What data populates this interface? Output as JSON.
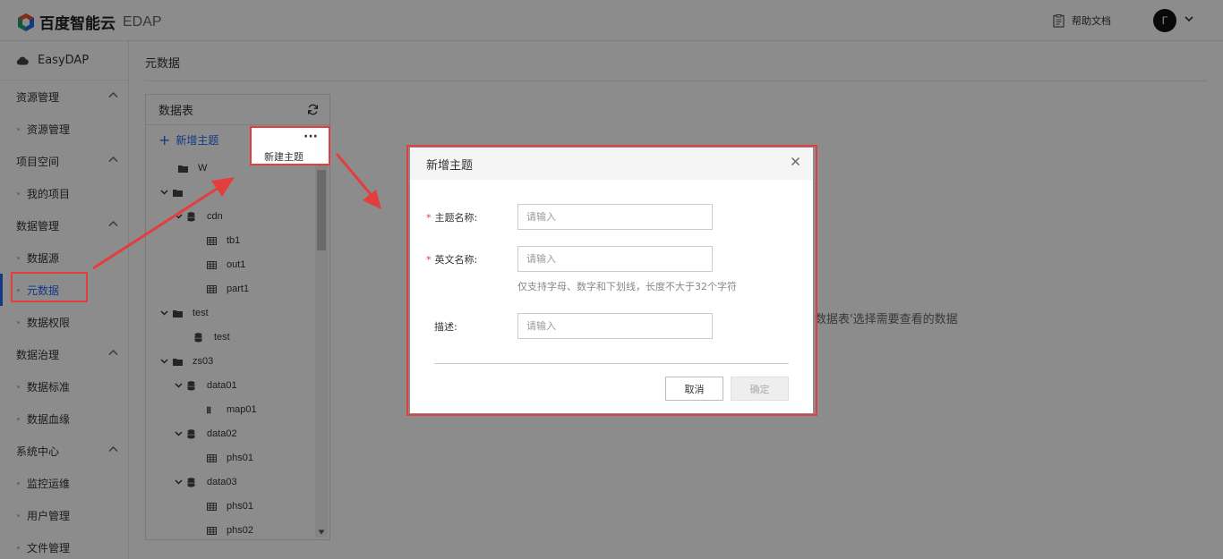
{
  "app": {
    "brand_name": "百度智能云",
    "product": "EDAP",
    "help_label": "帮助文档",
    "avatar_initial": "Γ"
  },
  "sidebar": {
    "product_name": "EasyDAP",
    "groups": [
      {
        "label": "资源管理",
        "items": [
          "资源管理"
        ]
      },
      {
        "label": "项目空间",
        "items": [
          "我的项目"
        ]
      },
      {
        "label": "数据管理",
        "items": [
          "数据源",
          "元数据",
          "数据权限"
        ]
      },
      {
        "label": "数据治理",
        "items": [
          "数据标准",
          "数据血缘"
        ]
      },
      {
        "label": "系统中心",
        "items": [
          "监控运维",
          "用户管理",
          "文件管理"
        ]
      }
    ],
    "active_item": "元数据"
  },
  "main": {
    "breadcrumb": "元数据",
    "empty_hint": "数据表'选择需要查看的数据"
  },
  "tree_panel": {
    "title": "数据表",
    "add_topic": "新增主题",
    "more_menu_item": "新建主题",
    "rows": [
      {
        "label": "W",
        "type": "folder",
        "expanded": false
      },
      {
        "label": "",
        "type": "folder",
        "expanded": true
      },
      {
        "label": "cdn",
        "type": "database",
        "expanded": true
      },
      {
        "label": "tb1",
        "type": "table"
      },
      {
        "label": "out1",
        "type": "table"
      },
      {
        "label": "part1",
        "type": "table"
      },
      {
        "label": "test",
        "type": "folder",
        "expanded": true
      },
      {
        "label": "test",
        "type": "database"
      },
      {
        "label": "zs03",
        "type": "folder",
        "expanded": true
      },
      {
        "label": "data01",
        "type": "database",
        "expanded": true
      },
      {
        "label": "map01",
        "type": "map"
      },
      {
        "label": "data02",
        "type": "database",
        "expanded": true
      },
      {
        "label": "phs01",
        "type": "table"
      },
      {
        "label": "data03",
        "type": "database",
        "expanded": true
      },
      {
        "label": "phs01",
        "type": "table"
      },
      {
        "label": "phs02",
        "type": "table"
      }
    ]
  },
  "dialog": {
    "title": "新增主题",
    "fields": {
      "topic_name": {
        "label": "主题名称:",
        "placeholder": "请输入",
        "required": true
      },
      "english_name": {
        "label": "英文名称:",
        "placeholder": "请输入",
        "required": true,
        "hint": "仅支持字母、数字和下划线，长度不大于32个字符"
      },
      "description": {
        "label": "描述:",
        "placeholder": "请输入",
        "required": false
      }
    },
    "cancel_label": "取消",
    "ok_label": "确定"
  },
  "colors": {
    "accent": "#2468f2",
    "highlight": "#e23e3e"
  }
}
